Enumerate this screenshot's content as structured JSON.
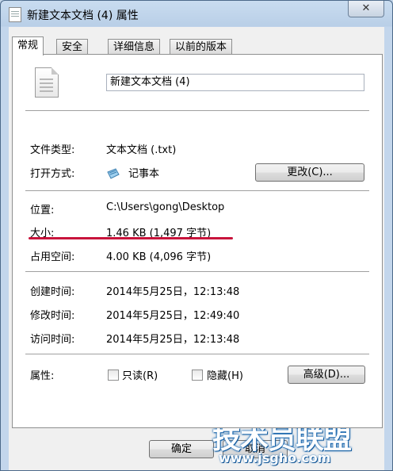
{
  "window": {
    "title": "新建文本文档 (4) 属性",
    "close_label": "✕"
  },
  "tabs": [
    {
      "label": "常规",
      "active": true
    },
    {
      "label": "安全",
      "active": false
    },
    {
      "label": "详细信息",
      "active": false
    },
    {
      "label": "以前的版本",
      "active": false
    }
  ],
  "general": {
    "file_name": "新建文本文档 (4)",
    "type_label": "文件类型:",
    "type_value": "文本文档 (.txt)",
    "opens_with_label": "打开方式:",
    "opens_with_value": "记事本",
    "change_button": "更改(C)...",
    "location_label": "位置:",
    "location_value": "C:\\Users\\gong\\Desktop",
    "size_label": "大小:",
    "size_value": "1.46 KB (1,497 字节)",
    "size_on_disk_label": "占用空间:",
    "size_on_disk_value": "4.00 KB (4,096 字节)",
    "created_label": "创建时间:",
    "created_value": "2014年5月25日，12:13:48",
    "modified_label": "修改时间:",
    "modified_value": "2014年5月25日，12:49:40",
    "accessed_label": "访问时间:",
    "accessed_value": "2014年5月25日，12:13:48",
    "attributes_label": "属性:",
    "readonly_label": "只读(R)",
    "hidden_label": "隐藏(H)",
    "advanced_button": "高级(D)..."
  },
  "footer": {
    "ok_button": "确定",
    "cancel_button": "取消"
  },
  "watermark": {
    "text": "技术员联盟",
    "url": "www.jsgho.com"
  },
  "colors": {
    "highlight_underline": "#c8143c"
  }
}
